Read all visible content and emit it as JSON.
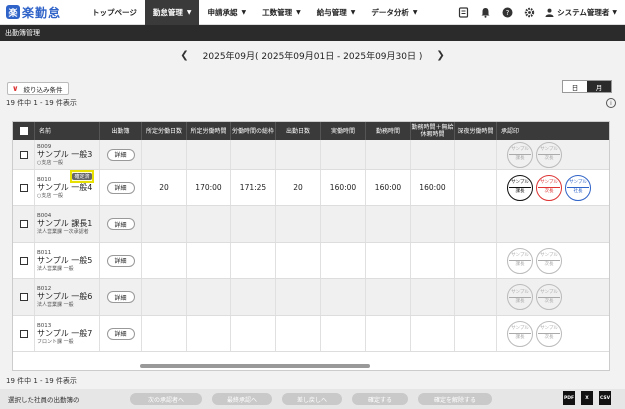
{
  "app": {
    "logo_mark": "楽",
    "logo_text": "楽勤怠"
  },
  "nav": [
    {
      "label": "トップページ",
      "caret": false,
      "active": false
    },
    {
      "label": "勤怠管理",
      "caret": true,
      "active": true
    },
    {
      "label": "申請承認",
      "caret": true,
      "active": false
    },
    {
      "label": "工数管理",
      "caret": true,
      "active": false
    },
    {
      "label": "給与管理",
      "caret": true,
      "active": false
    },
    {
      "label": "データ分析",
      "caret": true,
      "active": false
    }
  ],
  "user": {
    "name": "システム管理者"
  },
  "page_title": "出勤簿管理",
  "month": {
    "label": "2025年09月( 2025年09月01日 - 2025年09月30日 )"
  },
  "filter": {
    "label": "絞り込み条件"
  },
  "view_toggle": {
    "day": "日",
    "month": "月",
    "active": "月"
  },
  "count_text": "19 件中 1 - 19 件表示",
  "table": {
    "headers": [
      "名前",
      "出勤簿",
      "所定労働日数",
      "所定労働時間",
      "労働時間の総枠",
      "出勤日数",
      "実働時間",
      "勤務時間",
      "勤務時間＋無給休暇時間",
      "深夜労働時間",
      "承認印"
    ],
    "detail_label": "詳細",
    "highlight_tag": "確定済",
    "rows": [
      {
        "code": "B009",
        "name": "サンプル 一般3",
        "sub": "○支店 一般",
        "values": [
          "",
          "",
          "",
          "",
          "",
          "",
          "",
          ""
        ],
        "stamps": "empty"
      },
      {
        "code": "B010",
        "name": "サンプル 一般4",
        "sub": "○支店 一般",
        "values": [
          "20",
          "170:00",
          "171:25",
          "20",
          "160:00",
          "160:00",
          "160:00",
          ""
        ],
        "stamps": "filled"
      },
      {
        "code": "B004",
        "name": "サンプル 課長1",
        "sub": "法人営業課 一次承認者",
        "values": [
          "",
          "",
          "",
          "",
          "",
          "",
          "",
          ""
        ],
        "stamps": "none"
      },
      {
        "code": "B011",
        "name": "サンプル 一般5",
        "sub": "法人営業課 一般",
        "values": [
          "",
          "",
          "",
          "",
          "",
          "",
          "",
          ""
        ],
        "stamps": "empty"
      },
      {
        "code": "B012",
        "name": "サンプル 一般6",
        "sub": "法人営業課 一般",
        "values": [
          "",
          "",
          "",
          "",
          "",
          "",
          "",
          ""
        ],
        "stamps": "empty"
      },
      {
        "code": "B013",
        "name": "サンプル 一般7",
        "sub": "フロント課 一般",
        "values": [
          "",
          "",
          "",
          "",
          "",
          "",
          "",
          ""
        ],
        "stamps": "empty"
      }
    ],
    "stamp_labels": {
      "empty": [
        {
          "top": "サンプル",
          "bottom": "課長"
        },
        {
          "top": "サンプル",
          "bottom": "次長"
        }
      ],
      "filled": [
        {
          "top": "サンプル",
          "bottom": "課長",
          "color": "black"
        },
        {
          "top": "サンプル",
          "bottom": "次長",
          "color": "red"
        },
        {
          "top": "サンプル",
          "bottom": "社長",
          "color": "blue"
        }
      ]
    }
  },
  "actionbar": {
    "label": "選択した社員の出勤簿の",
    "buttons": [
      "次の承認者へ",
      "最終承認へ",
      "差し戻しへ",
      "確定する",
      "確定を解除する"
    ]
  },
  "export": [
    "PDF",
    "X",
    "CSV"
  ]
}
